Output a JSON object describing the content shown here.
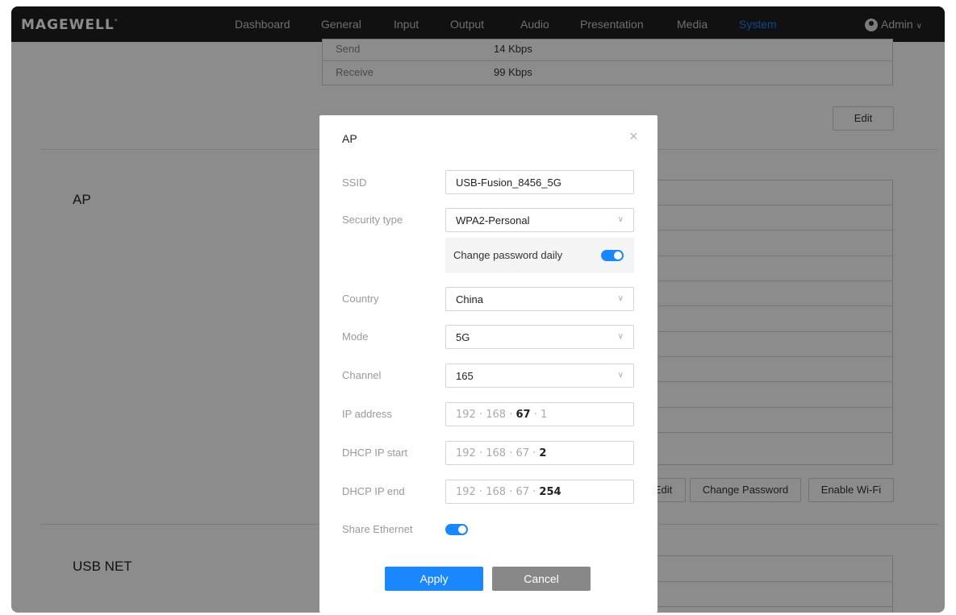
{
  "logo": {
    "text": "MAGEWELL",
    "mark": "°"
  },
  "nav": {
    "items": [
      {
        "label": "Dashboard"
      },
      {
        "label": "General"
      },
      {
        "label": "Input"
      },
      {
        "label": "Output"
      },
      {
        "label": "Audio"
      },
      {
        "label": "Presentation"
      },
      {
        "label": "Media"
      },
      {
        "label": "System"
      }
    ],
    "active": "System",
    "user": "Admin"
  },
  "background": {
    "traffic_rows": [
      {
        "label": "Send",
        "value": "14 Kbps"
      },
      {
        "label": "Receive",
        "value": "99 Kbps"
      }
    ],
    "edit_label": "Edit",
    "ap_section_title": "AP",
    "usb_section_title": "USB NET",
    "ap_edit_label": "Edit",
    "change_password_label": "Change Password",
    "enable_wifi_label": "Enable Wi-Fi"
  },
  "modal": {
    "title": "AP",
    "close_symbol": "×",
    "ssid_label": "SSID",
    "ssid_value": "USB-Fusion_8456_5G",
    "security_label": "Security type",
    "security_value": "WPA2-Personal",
    "change_password_daily_label": "Change password daily",
    "change_password_daily_on": true,
    "country_label": "Country",
    "country_value": "China",
    "mode_label": "Mode",
    "mode_value": "5G",
    "channel_label": "Channel",
    "channel_value": "165",
    "ip_label": "IP address",
    "ip": [
      "192",
      "168",
      "67",
      "1"
    ],
    "dhcp_start_label": "DHCP IP start",
    "dhcp_start": [
      "192",
      "168",
      "67",
      "2"
    ],
    "dhcp_end_label": "DHCP IP end",
    "dhcp_end": [
      "192",
      "168",
      "67",
      "254"
    ],
    "share_ethernet_label": "Share Ethernet",
    "share_ethernet_on": true,
    "apply_label": "Apply",
    "cancel_label": "Cancel"
  },
  "colors": {
    "accent": "#1a86ff",
    "navbar": "#1f1f1f",
    "cancel": "#888888"
  }
}
